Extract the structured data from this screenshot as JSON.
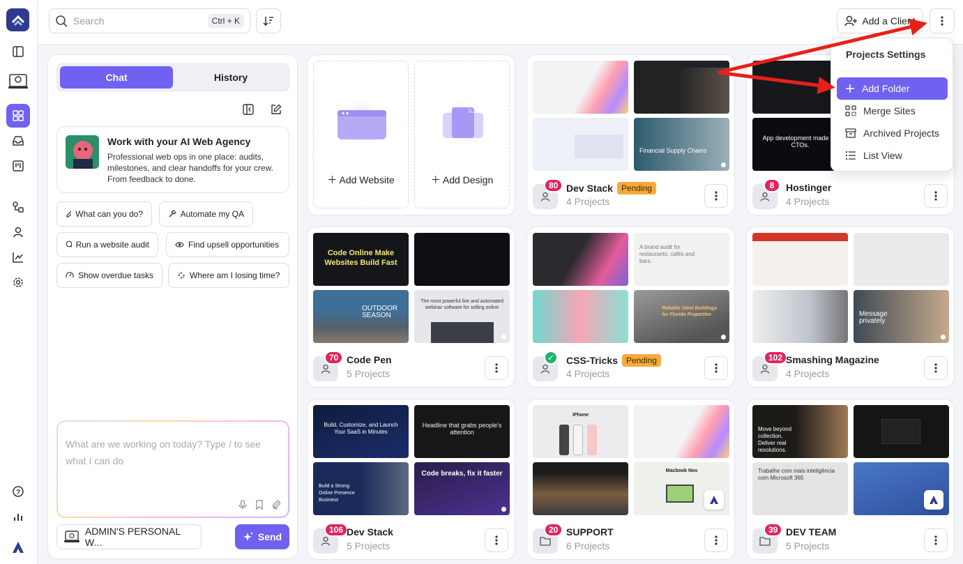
{
  "topbar": {
    "search_placeholder": "Search",
    "search_shortcut": "Ctrl + K",
    "add_client_label": "Add a Client"
  },
  "chat": {
    "tab_chat": "Chat",
    "tab_history": "History",
    "agency_title": "Work with your AI Web Agency",
    "agency_desc": "Professional web ops in one place: audits, milestones, and clear handoffs for your crew. From feedback to done.",
    "suggestions": [
      "What can you do?",
      "Automate my QA",
      "Run a website audit",
      "Find upsell opportunities",
      "Show overdue tasks",
      "Where am I losing time?"
    ],
    "input_placeholder": "What are we working on today? Type / to see what I can do",
    "workspace_label": "ADMIN'S PERSONAL W...",
    "send_label": "Send"
  },
  "add_card": {
    "add_website": "Add Website",
    "add_design": "Add Design"
  },
  "projects": [
    {
      "name": "Dev Stack",
      "count": "80",
      "sub": "4 Projects",
      "status": "Pending",
      "kind": "client"
    },
    {
      "name": "Hostinger",
      "count": "8",
      "sub": "4 Projects",
      "status": "",
      "kind": "client"
    },
    {
      "name": "Code Pen",
      "count": "70",
      "sub": "5 Projects",
      "status": "",
      "kind": "client"
    },
    {
      "name": "CSS-Tricks",
      "count": "✓",
      "sub": "4 Projects",
      "status": "Pending",
      "kind": "client"
    },
    {
      "name": "Smashing Magazine",
      "count": "102",
      "sub": "4 Projects",
      "status": "",
      "kind": "client"
    },
    {
      "name": "Dev Stack",
      "count": "106",
      "sub": "5 Projects",
      "status": "",
      "kind": "client"
    },
    {
      "name": "SUPPORT",
      "count": "20",
      "sub": "6 Projects",
      "status": "",
      "kind": "folder"
    },
    {
      "name": "DEV TEAM",
      "count": "39",
      "sub": "5 Projects",
      "status": "",
      "kind": "folder"
    }
  ],
  "thumb_texts": {
    "codepen_1": "Code Online Make Websites Build Fast",
    "codepen_3": "OUTDOOR SEASON",
    "codepen_4": "The most powerful live and automated webinar software for selling online",
    "devstack2_1": "Build, Customize, and Launch Your SaaS in Minutes",
    "devstack2_2": "Headline that grabs people's attention",
    "devstack2_3": "Build a Strong Online Presence Business",
    "devstack2_4": "Code breaks, fix it faster",
    "devstack1_4": "Financial Supply Chains",
    "hostinger_3": "App development made for CTOs.",
    "smashing_4": "Message privately",
    "css_4": "Reliable Steel Buildings for Florida Properties",
    "css_2": "A brand audit for restaurants, cafés and bars.",
    "devteam_1": "Move beyond collection. Deliver real resolutions.",
    "devteam_3": "Trabalhe com mais inteligência com Microsoft 365",
    "support_1": "iPhone",
    "support_4": "Macbook Neo"
  },
  "menu": {
    "header": "Projects Settings",
    "items": [
      "Add Folder",
      "Merge Sites",
      "Archived Projects",
      "List View"
    ]
  },
  "colors": {
    "accent": "#7061f0",
    "badge": "#e0245e",
    "pending": "#f7a93b",
    "annotation_arrow": "#e8201a"
  }
}
